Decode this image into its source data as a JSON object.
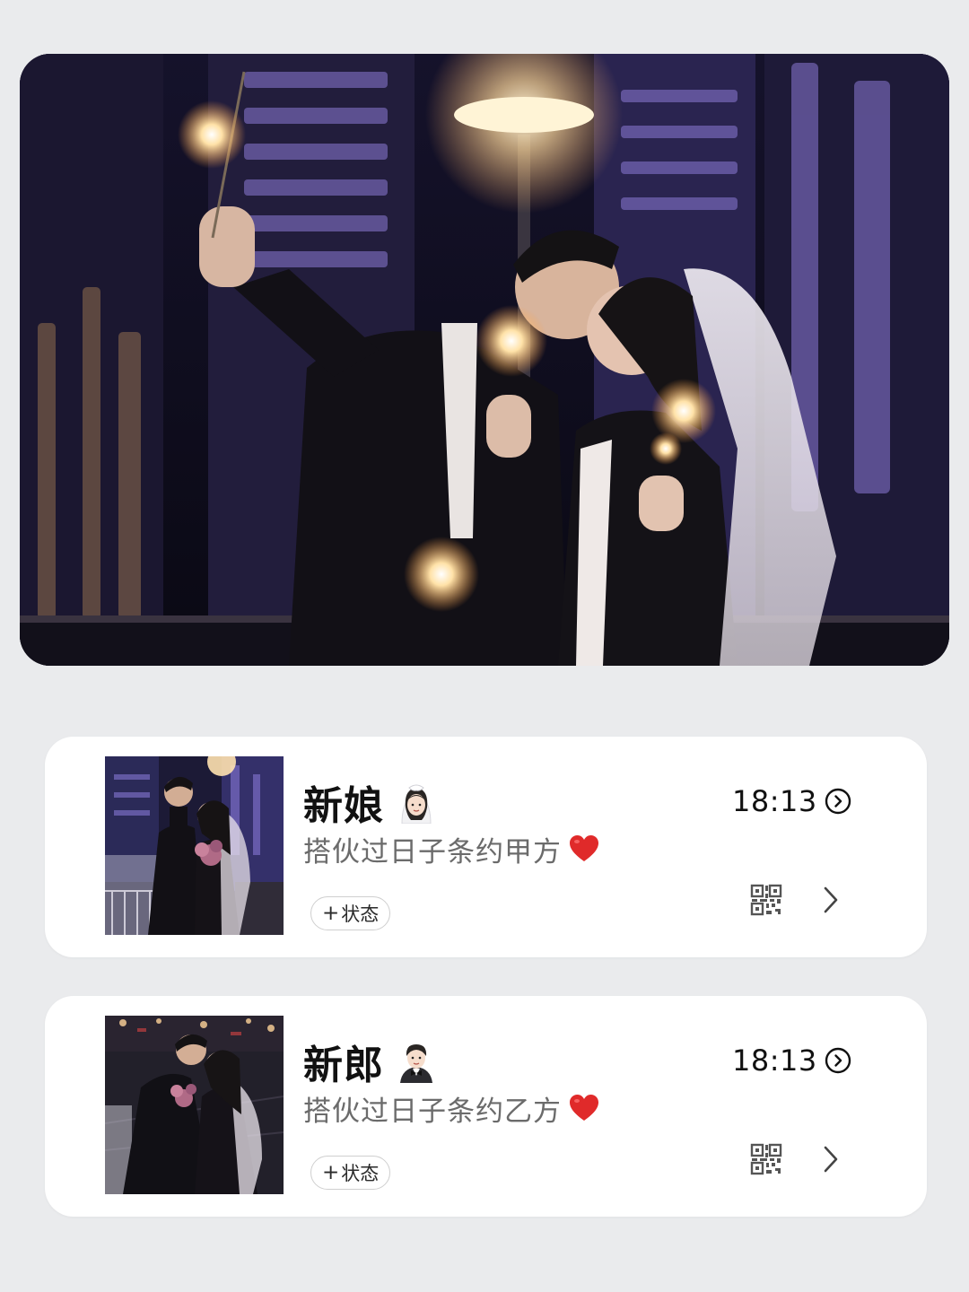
{
  "hero": {
    "icon": "wedding-photo"
  },
  "profiles": [
    {
      "name": "新娘",
      "emoji": "bride-emoji",
      "signature": "搭伙过日子条约甲方",
      "signature_emoji": "red-heart",
      "time": "18:13",
      "status_plus": "+",
      "status_label": "状态"
    },
    {
      "name": "新郎",
      "emoji": "groom-emoji",
      "signature": "搭伙过日子条约乙方",
      "signature_emoji": "red-heart",
      "time": "18:13",
      "status_plus": "+",
      "status_label": "状态"
    }
  ],
  "colors": {
    "background": "#eaebed",
    "card": "#ffffff",
    "heart": "#e02a2a",
    "text_primary": "#111111",
    "text_secondary": "#6b6b6b"
  }
}
